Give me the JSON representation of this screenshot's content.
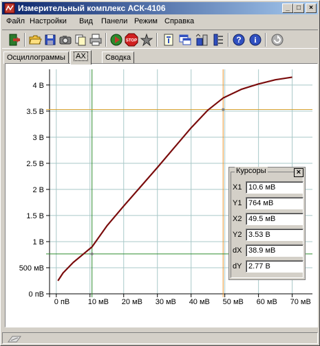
{
  "window": {
    "title": "Измерительный комплекс АСК-4106",
    "minimize_label": "_",
    "maximize_label": "□",
    "close_label": "×"
  },
  "menu": [
    "Файл",
    "Настройки",
    "Вид",
    "Панели",
    "Режим",
    "Справка"
  ],
  "toolbar_icons": [
    "exit-icon",
    "open-icon",
    "save-icon",
    "camera-icon",
    "copy-icon",
    "print-icon",
    "run-icon",
    "stop-icon",
    "auto-icon",
    "info-panel-icon",
    "window-icon",
    "generator-icon",
    "settings-icon",
    "help-icon",
    "about-icon",
    "refresh-icon"
  ],
  "tabs": [
    {
      "label": "Осциллограммы",
      "active": false
    },
    {
      "label": "AX",
      "active": true
    },
    {
      "label": "Сводка",
      "active": false
    }
  ],
  "cursors_panel": {
    "title": "Курсоры",
    "close_label": "×",
    "rows": [
      {
        "label": "X1",
        "value": "10.6 мВ"
      },
      {
        "label": "Y1",
        "value": "764 мВ"
      },
      {
        "label": "X2",
        "value": "49.5 мВ"
      },
      {
        "label": "Y2",
        "value": "3.53 В"
      },
      {
        "label": "dX",
        "value": "38.9 мВ"
      },
      {
        "label": "dY",
        "value": "2.77 В"
      }
    ]
  },
  "chart_data": {
    "type": "line",
    "title": "",
    "xlabel": "",
    "ylabel": "",
    "xlim": [
      -2,
      76
    ],
    "ylim": [
      0,
      4.3
    ],
    "x_ticks": [
      0,
      10,
      20,
      30,
      40,
      50,
      60,
      70
    ],
    "x_tick_labels": [
      "0 пВ",
      "10 мВ",
      "20 мВ",
      "30 мВ",
      "40 мВ",
      "50 мВ",
      "60 мВ",
      "70 мВ"
    ],
    "y_ticks": [
      0,
      0.5,
      1,
      1.5,
      2,
      2.5,
      3,
      3.5,
      4
    ],
    "y_tick_labels": [
      "0 пВ",
      "500 мВ",
      "1 В",
      "1.5 В",
      "2 В",
      "2.5 В",
      "3 В",
      "3.5 В",
      "4 В"
    ],
    "grid": true,
    "series": [
      {
        "color": "#7a0c0c",
        "x": [
          0.5,
          2,
          5,
          8,
          10.6,
          15,
          20,
          25,
          30,
          35,
          40,
          45,
          49.5,
          55,
          60,
          65,
          70
        ],
        "y": [
          0.25,
          0.4,
          0.6,
          0.76,
          0.9,
          1.3,
          1.68,
          2.05,
          2.42,
          2.8,
          3.18,
          3.52,
          3.75,
          3.92,
          4.02,
          4.1,
          4.15
        ]
      }
    ],
    "cursors": {
      "x1": 10.6,
      "x2": 49.5,
      "y1": 0.764,
      "y2": 3.53,
      "x1_color": "#2e8b2e",
      "x2_color": "#e8902a",
      "y1_color": "#2e8b2e",
      "y2_color": "#d4a030"
    }
  },
  "status": {
    "icon": "status-icon"
  }
}
